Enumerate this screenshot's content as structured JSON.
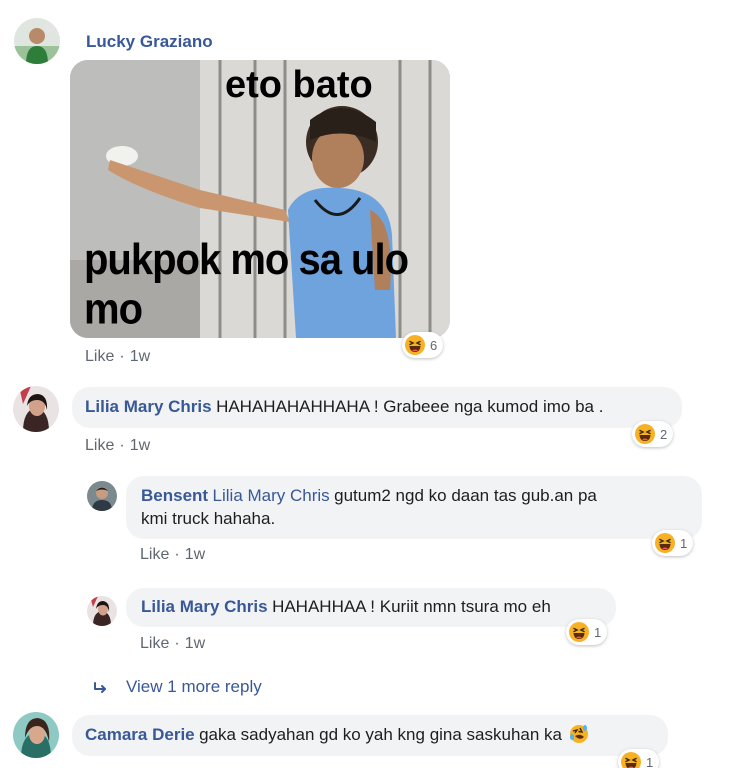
{
  "comments": [
    {
      "author": "Lucky Graziano",
      "image_caption_top": "eto bato",
      "image_caption_bottom": "pukpok mo sa ulo mo",
      "like_label": "Like",
      "time": "1w",
      "reaction_icon": "haha-emoji-icon",
      "reaction_count": "6"
    },
    {
      "author": "Lilia Mary Chris",
      "text": "HAHAHAHAHHAHA ! Grabeee nga kumod imo ba .",
      "like_label": "Like",
      "time": "1w",
      "reaction_icon": "haha-emoji-icon",
      "reaction_count": "2",
      "replies": [
        {
          "author": "Bensent",
          "mention": "Lilia Mary Chris",
          "text_line1": "gutum2 ngd ko daan tas gub.an pa",
          "text_line2": "kmi truck hahaha.",
          "like_label": "Like",
          "time": "1w",
          "reaction_icon": "haha-emoji-icon",
          "reaction_count": "1"
        },
        {
          "author": "Lilia Mary Chris",
          "text": "HAHAHHAA ! Kuriit nmn tsura mo eh",
          "like_label": "Like",
          "time": "1w",
          "reaction_icon": "haha-emoji-icon",
          "reaction_count": "1"
        }
      ],
      "view_more_label": "View 1 more reply"
    },
    {
      "author": "Camara Derie",
      "text": "gaka sadyahan gd ko yah kng gina saskuhan ka",
      "inline_emoji": "rofl-emoji-icon",
      "reaction_icon": "haha-emoji-icon",
      "reaction_count": "1"
    }
  ],
  "colors": {
    "name": "#385898",
    "bubble": "#f2f3f5",
    "meta": "#606770",
    "emoji_face": "#f7b125"
  }
}
